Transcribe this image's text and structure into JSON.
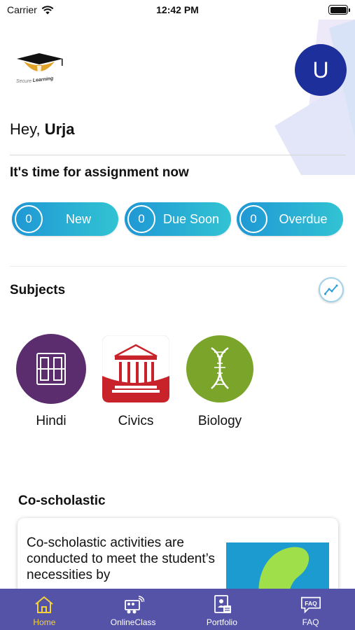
{
  "status_bar": {
    "carrier": "Carrier",
    "time": "12:42 PM"
  },
  "header": {
    "logo_text": "Secure Learning",
    "avatar_initial": "U",
    "greeting_prefix": "Hey,",
    "user_name": "Urja"
  },
  "assignments": {
    "title": "It's time for assignment now",
    "pills": [
      {
        "count": "0",
        "label": "New"
      },
      {
        "count": "0",
        "label": "Due Soon"
      },
      {
        "count": "0",
        "label": "Overdue"
      }
    ]
  },
  "subjects": {
    "title": "Subjects",
    "trend_icon": "trend-icon",
    "items": [
      {
        "label": "Hindi",
        "icon": "hindi-icon",
        "color": "#5b2d6e"
      },
      {
        "label": "Civics",
        "icon": "civics-icon",
        "color": "#c8232b"
      },
      {
        "label": "Biology",
        "icon": "biology-icon",
        "color": "#7aa52a"
      }
    ]
  },
  "co_scholastic": {
    "title": "Co-scholastic",
    "description": "Co-scholastic activities are conducted to meet the student’s necessities by"
  },
  "tab_bar": {
    "active_color": "#f4d23a",
    "background": "#5553a8",
    "tabs": [
      {
        "label": "Home",
        "icon": "home-icon",
        "active": true
      },
      {
        "label": "OnlineClass",
        "icon": "online-class-icon",
        "active": false
      },
      {
        "label": "Portfolio",
        "icon": "portfolio-icon",
        "active": false
      },
      {
        "label": "FAQ",
        "icon": "faq-icon",
        "active": false
      }
    ]
  }
}
